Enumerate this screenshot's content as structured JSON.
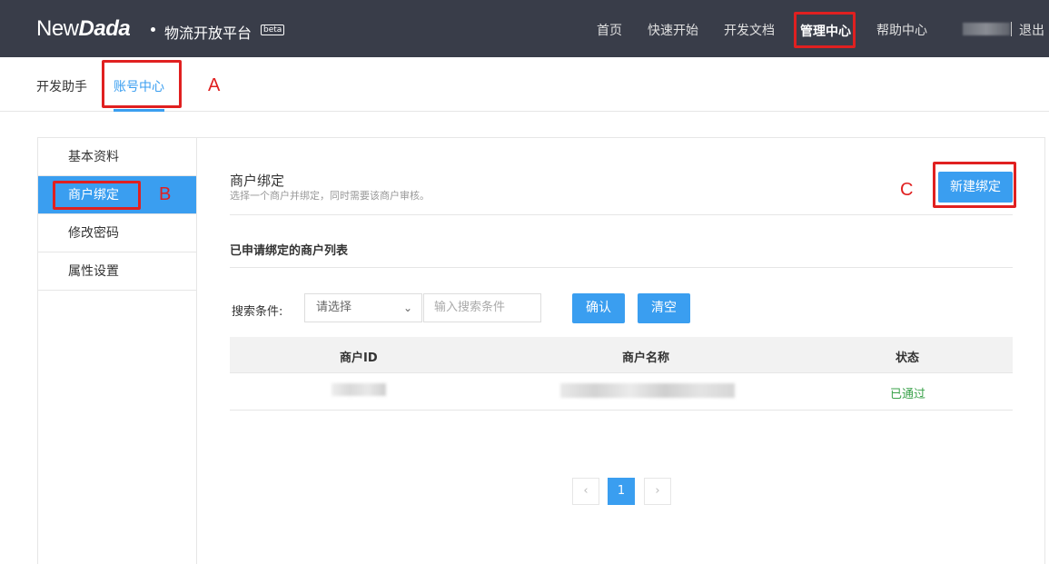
{
  "topnav": {
    "logo_light": "New",
    "logo_bold": "Dada",
    "platform": "物流开放平台",
    "beta": "beta",
    "items": [
      "首页",
      "快速开始",
      "开发文档"
    ],
    "active": "管理中心",
    "help": "帮助中心",
    "logout": "退出"
  },
  "subtabs": [
    "开发助手",
    "账号中心"
  ],
  "annotations": {
    "a": "A",
    "b": "B",
    "c": "C"
  },
  "sidebar": [
    "基本资料",
    "商户绑定",
    "修改密码",
    "属性设置"
  ],
  "main": {
    "section_title": "商户绑定",
    "section_desc": "选择一个商户并绑定，同时需要该商户审核。",
    "new_button": "新建绑定",
    "list_title": "已申请绑定的商户列表",
    "search_label": "搜索条件:",
    "select_placeholder": "请选择",
    "input_placeholder": "输入搜索条件",
    "confirm": "确认",
    "clear": "清空",
    "columns": [
      "商户ID",
      "商户名称",
      "状态"
    ],
    "rows": [
      {
        "status": "已通过"
      }
    ]
  },
  "pagination": {
    "prev": "‹",
    "current": "1",
    "next": "›"
  },
  "colors": {
    "topbar": "#393d49",
    "accent": "#3a9ef0",
    "highlight": "#e02020",
    "success": "#3aa14a"
  }
}
